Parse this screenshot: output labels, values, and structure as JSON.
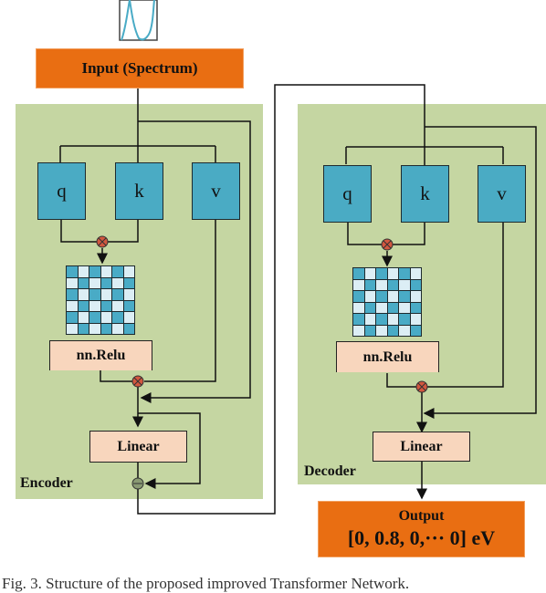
{
  "input": {
    "label": "Input (Spectrum)",
    "icon": "spectrum-plot-icon"
  },
  "encoder": {
    "label": "Encoder",
    "q_label": "q",
    "k_label": "k",
    "v_label": "v",
    "activation_label": "nn.Relu",
    "linear_label": "Linear",
    "multiply_op": "⊗",
    "subtract_op": "⊖"
  },
  "decoder": {
    "label": "Decoder",
    "q_label": "q",
    "k_label": "k",
    "v_label": "v",
    "activation_label": "nn.Relu",
    "linear_label": "Linear",
    "multiply_op": "⊗"
  },
  "output": {
    "title": "Output",
    "value": "[0, 0.8, 0,··· 0] eV"
  },
  "colors": {
    "panel": "#c5d6a2",
    "orange": "#e96e12",
    "qkv": "#4aabc4",
    "peach": "#f8d6bd",
    "attention_dark": "#49abc6",
    "attention_light": "#dceef5",
    "multiply_node": "#d2573f"
  },
  "caption": "Fig. 3. Structure of the proposed improved Transformer Network."
}
